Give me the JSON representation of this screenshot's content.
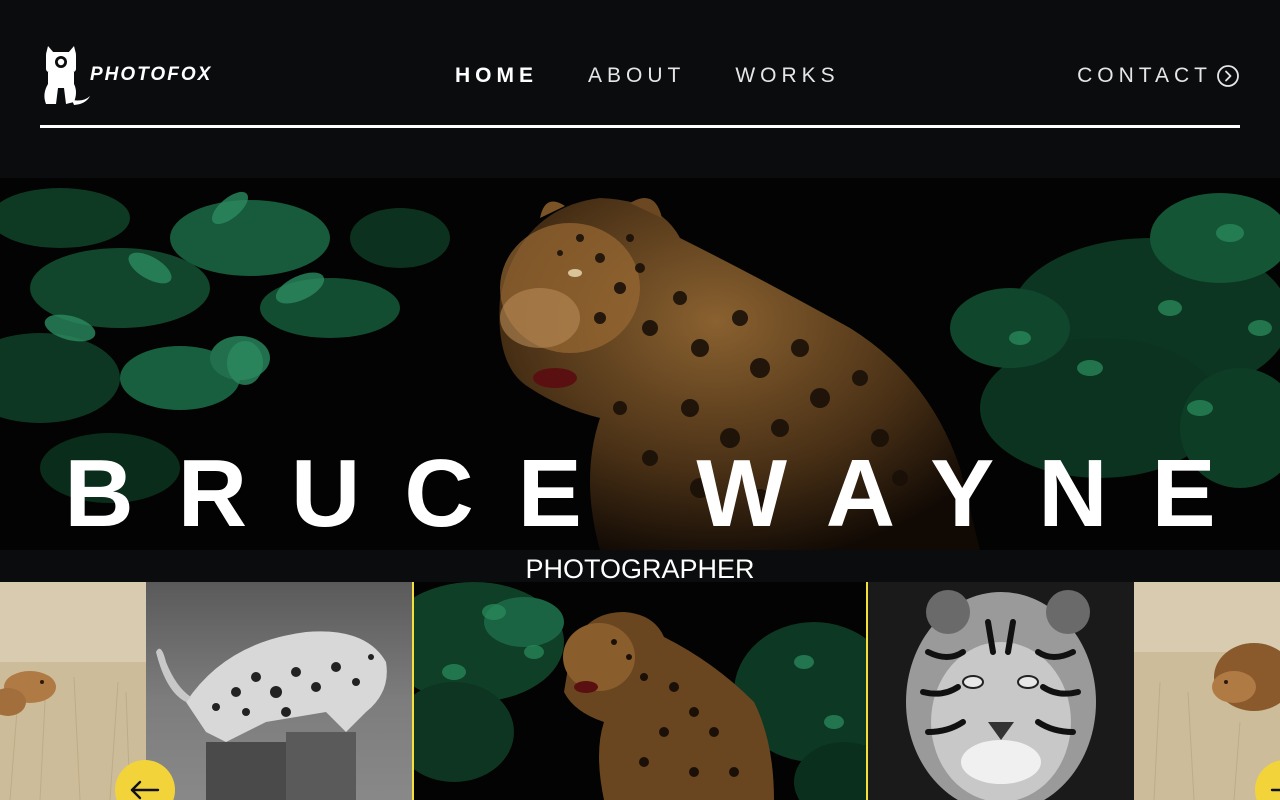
{
  "brand": {
    "name": "PHOTOFOX",
    "icon": "fox-camera-logo-icon"
  },
  "nav": {
    "items": [
      {
        "label": "HOME",
        "active": true
      },
      {
        "label": "ABOUT",
        "active": false
      },
      {
        "label": "WORKS",
        "active": false
      }
    ],
    "contact": {
      "label": "CONTACT",
      "icon": "circle-chevron-right-icon"
    }
  },
  "hero": {
    "title": "BRUCE WAYNE",
    "subtitle": "PHOTOGRAPHER",
    "image": "jaguar-in-jungle-photo"
  },
  "carousel": {
    "slides": [
      {
        "image": "lioness-in-grass-photo",
        "active": false
      },
      {
        "image": "leopard-on-stump-bw-photo",
        "active": false
      },
      {
        "image": "jaguar-in-jungle-photo",
        "active": true
      },
      {
        "image": "tiger-portrait-bw-photo",
        "active": false
      },
      {
        "image": "lion-in-grass-photo",
        "active": false
      }
    ],
    "prev_icon": "arrow-left-icon",
    "next_icon": "arrow-right-icon"
  },
  "colors": {
    "background": "#0b0c0e",
    "accent": "#f2d43a",
    "text": "#ffffff"
  }
}
